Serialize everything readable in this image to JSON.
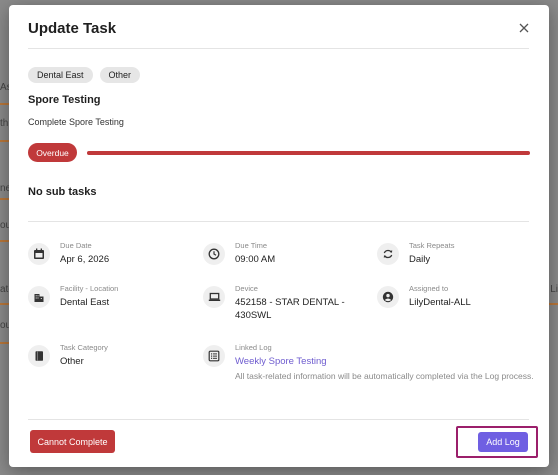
{
  "modal": {
    "title": "Update Task",
    "tags": [
      "Dental East",
      "Other"
    ],
    "task_title": "Spore Testing",
    "task_description": "Complete Spore Testing",
    "status_badge": "Overdue",
    "progress": 1.0,
    "subtasks_heading": "No sub tasks"
  },
  "details": {
    "due_date": {
      "label": "Due Date",
      "value": "Apr 6, 2026",
      "icon": "calendar-icon"
    },
    "due_time": {
      "label": "Due Time",
      "value": "09:00 AM",
      "icon": "clock-icon"
    },
    "task_repeats": {
      "label": "Task Repeats",
      "value": "Daily",
      "icon": "repeat-icon"
    },
    "facility": {
      "label": "Facility - Location",
      "value": "Dental East",
      "icon": "building-icon"
    },
    "device": {
      "label": "Device",
      "value": "452158 - STAR DENTAL - 430SWL",
      "icon": "laptop-icon"
    },
    "assigned": {
      "label": "Assigned to",
      "value": "LilyDental-ALL",
      "icon": "account-circle-icon"
    },
    "category": {
      "label": "Task Category",
      "value": "Other",
      "icon": "book-icon"
    },
    "linked_log": {
      "label": "Linked Log",
      "value": "Weekly Spore Testing",
      "note": "All task-related information will be automatically completed via the Log process.",
      "icon": "list-icon"
    }
  },
  "buttons": {
    "cannot_complete": "Cannot Complete",
    "add_log": "Add Log"
  },
  "background": {
    "left_fragments": [
      "As",
      "th",
      "ne",
      "ou",
      "ate",
      "ou"
    ],
    "right_fragments": [
      "Li"
    ]
  },
  "colors": {
    "danger": "#c0393a",
    "primary": "#6f5fe2",
    "link": "#6e5ccf",
    "highlight_border": "#9b1f6b"
  }
}
